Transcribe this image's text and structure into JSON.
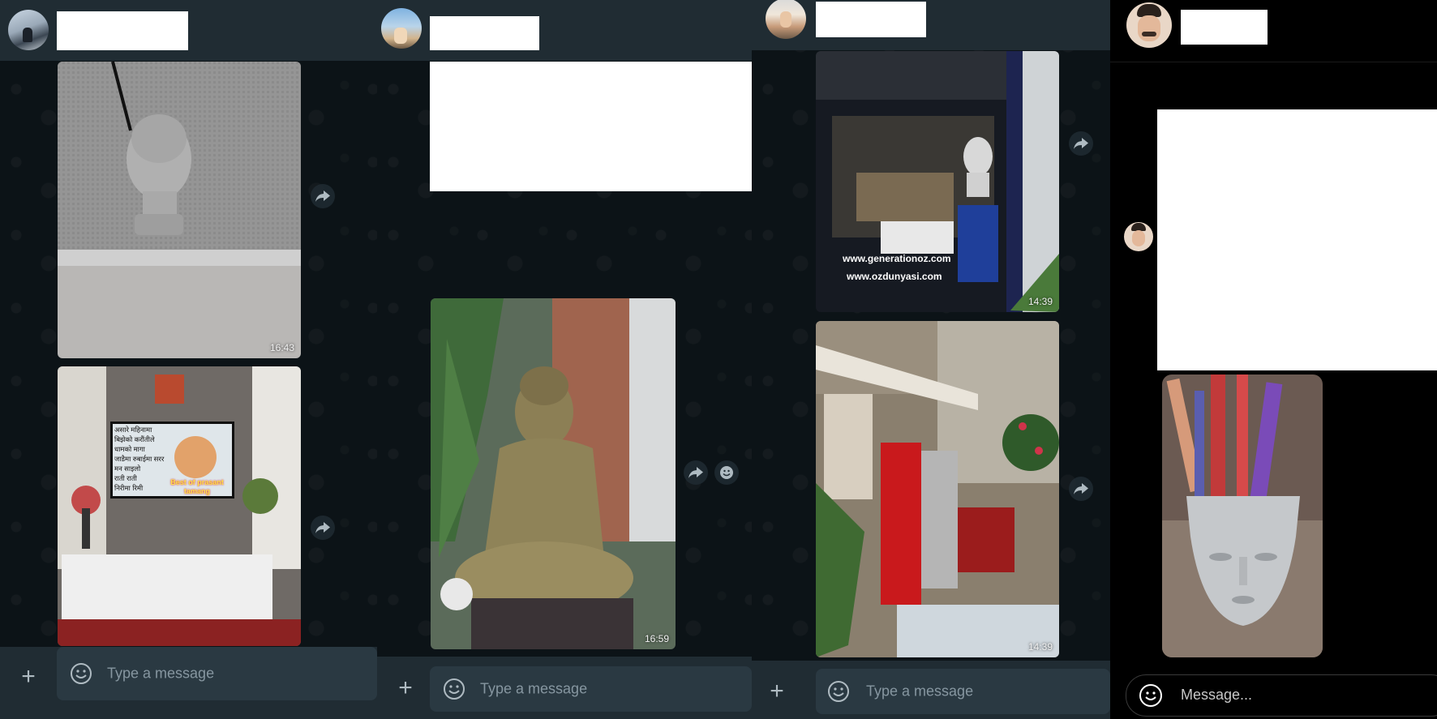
{
  "panels": [
    {
      "timestamps": [
        "16:43"
      ],
      "composer": {
        "placeholder": "Type a message"
      }
    },
    {
      "timestamps": [
        "16:59"
      ],
      "composer": {
        "placeholder": "Type a message"
      }
    },
    {
      "timestamps": [
        "14:39",
        "14:39"
      ],
      "composer": {
        "placeholder": "Type a message"
      },
      "photo_text": [
        "www.generationoz.com",
        "www.ozdunyasi.com"
      ]
    },
    {
      "composer": {
        "placeholder": "Message..."
      }
    }
  ],
  "tv_text": [
    "असारे महिनामा",
    "बिझेको करौंतीले",
    "धामको मागा",
    "जाडैमा रुबाईमा सरर",
    "मन साइलो",
    "राती राती",
    "निरीमा रिमी",
    "Best of prasant tamang"
  ],
  "icons": {
    "forward": "forward-arrow-icon",
    "emoji": "emoji-icon",
    "attach": "plus-icon",
    "react": "smiley-react-icon"
  },
  "colors": {
    "header": "#202c33",
    "input": "#2a3942",
    "placeholder": "#8696a0",
    "icon": "#aebac1"
  }
}
